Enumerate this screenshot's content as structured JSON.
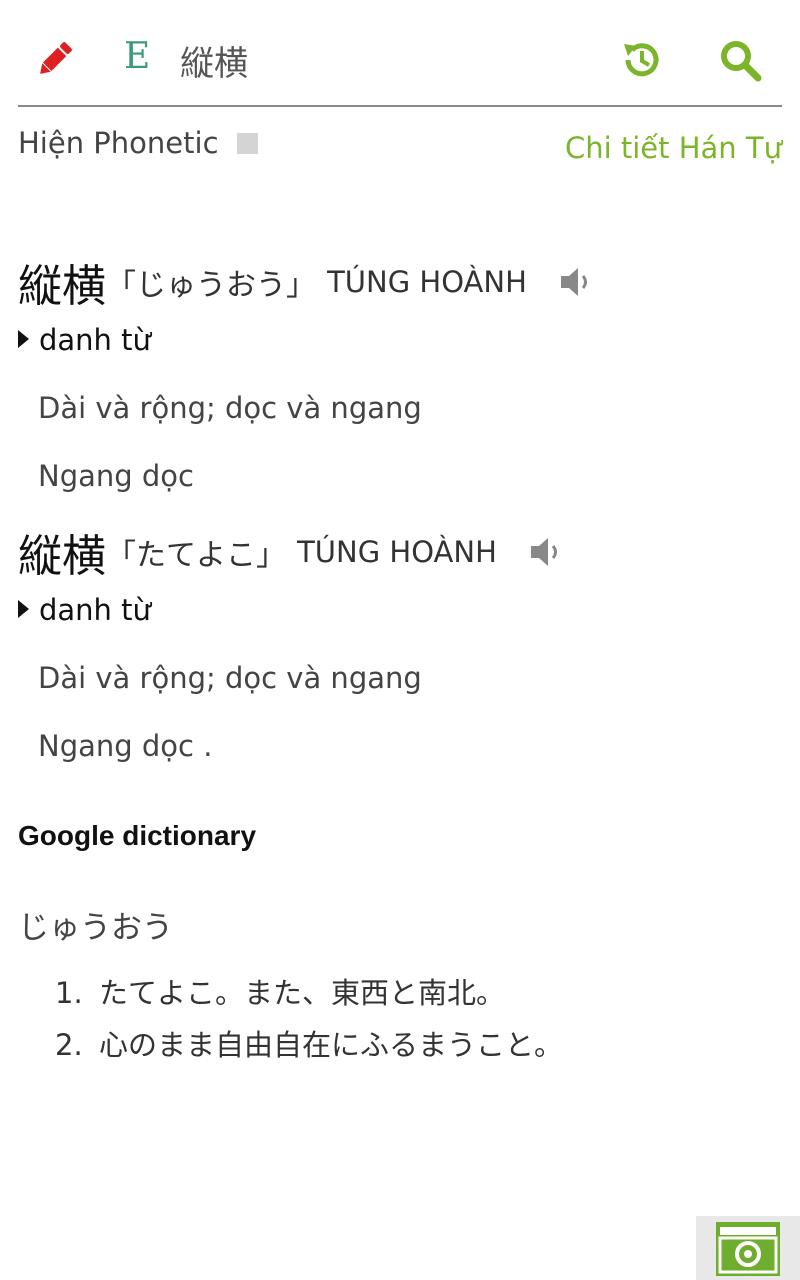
{
  "header": {
    "edit_icon": "pencil-icon",
    "lang_badge": "E",
    "query": "縦横",
    "history_icon": "history-icon",
    "search_icon": "search-icon"
  },
  "options": {
    "phonetic_label": "Hiện Phonetic",
    "phonetic_checked": false,
    "kanji_detail_link": "Chi tiết Hán Tự"
  },
  "entries": [
    {
      "kanji": "縦横",
      "reading": "「じゅうおう」",
      "hanviet": "TÚNG HOÀNH",
      "pos": "danh từ",
      "meanings": [
        "Dài và rộng; dọc và ngang",
        "Ngang dọc"
      ]
    },
    {
      "kanji": "縦横",
      "reading": "「たてよこ」",
      "hanviet": "TÚNG HOÀNH",
      "pos": "danh từ",
      "meanings": [
        "Dài và rộng; dọc và ngang",
        "Ngang dọc ."
      ]
    }
  ],
  "google": {
    "title": "Google dictionary",
    "reading": "じゅうおう",
    "definitions": [
      {
        "num": "1.",
        "text": "たてよこ。また、東西と南北。"
      },
      {
        "num": "2.",
        "text": "心のまま自由自在にふるまうこと。"
      }
    ]
  },
  "colors": {
    "accent_green": "#7cb42a",
    "edit_red": "#e02020",
    "badge_teal": "#3a9a7a"
  }
}
